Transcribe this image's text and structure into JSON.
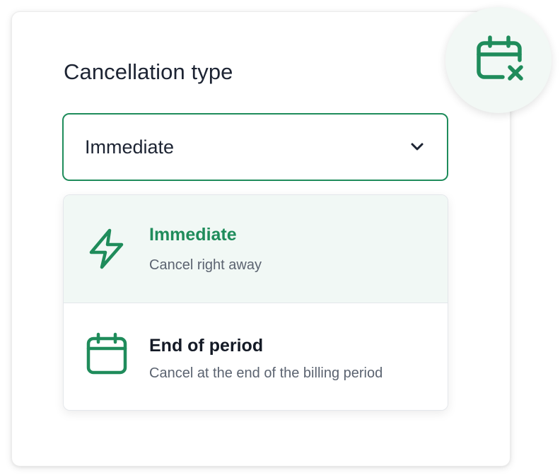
{
  "colors": {
    "accent": "#1f8c5b",
    "selected_background": "#f1f8f5",
    "text_primary": "#1d2433",
    "text_secondary": "#5b6370"
  },
  "field": {
    "label": "Cancellation type",
    "selected_value": "Immediate",
    "expanded": true
  },
  "badge": {
    "icon": "calendar-x-icon"
  },
  "options": [
    {
      "title": "Immediate",
      "description": "Cancel right away",
      "icon": "lightning-bolt-icon",
      "selected": true
    },
    {
      "title": "End of period",
      "description": "Cancel at the end of the billing period",
      "icon": "calendar-icon",
      "selected": false
    }
  ]
}
